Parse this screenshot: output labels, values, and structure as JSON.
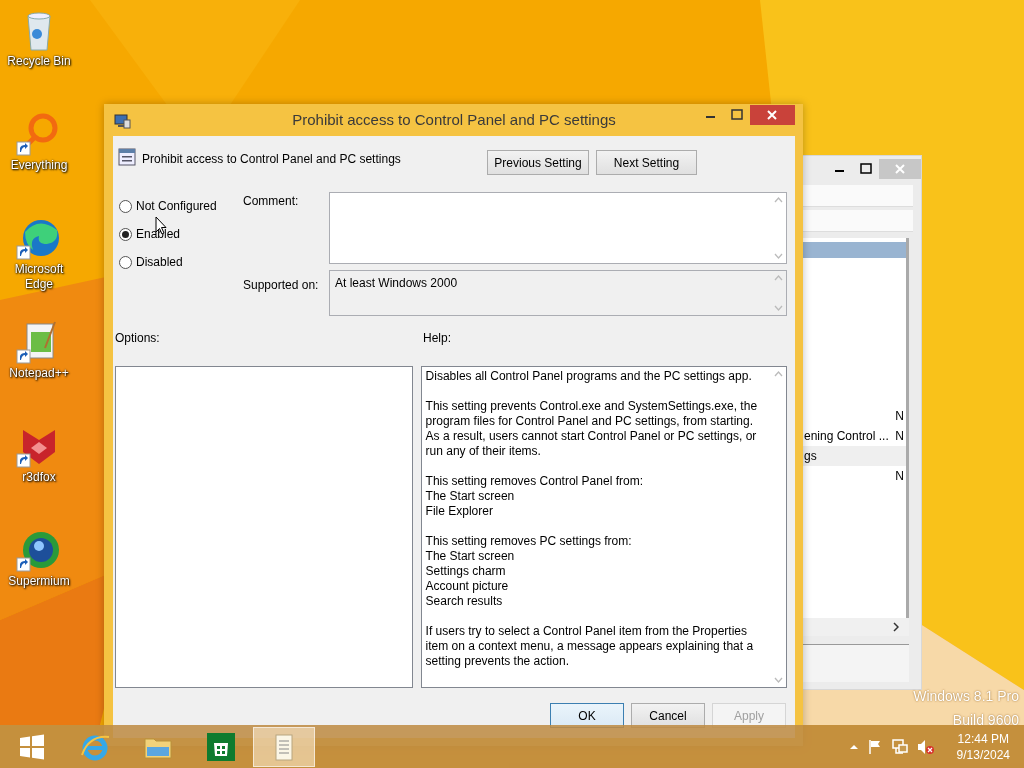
{
  "desktop_icons": [
    {
      "kind": "recycle",
      "label": "Recycle Bin"
    },
    {
      "kind": "ring",
      "label": "Everything"
    },
    {
      "kind": "swirl",
      "label": "Microsoft Edge"
    },
    {
      "kind": "notepad",
      "label": "Notepad++"
    },
    {
      "kind": "fox",
      "label": "r3dfox"
    },
    {
      "kind": "globe",
      "label": "Supermium"
    }
  ],
  "background_window": {
    "rows": [
      {
        "kind": "item",
        "selected": true
      },
      {
        "kind": "item",
        "selected": false,
        "value": "N"
      },
      {
        "kind": "item",
        "selected": false,
        "text": "ening Control ...",
        "value": "N"
      },
      {
        "kind": "group",
        "text": "gs"
      },
      {
        "kind": "item",
        "selected": false,
        "value": "N"
      }
    ]
  },
  "dialog": {
    "title": "Prohibit access to Control Panel and PC settings",
    "setting_name": "Prohibit access to Control Panel and PC settings",
    "nav_buttons": [
      "Previous Setting",
      "Next Setting"
    ],
    "radios": [
      {
        "label": "Not Configured",
        "selected": false
      },
      {
        "label": "Enabled",
        "selected": true
      },
      {
        "label": "Disabled",
        "selected": false
      }
    ],
    "comment_label": "Comment:",
    "supported_label": "Supported on:",
    "supported_value": "At least Windows 2000",
    "options_label": "Options:",
    "help_label": "Help:",
    "help": [
      [
        "Disables all Control Panel programs and the PC settings app."
      ],
      [
        "This setting prevents Control.exe and SystemSettings.exe, the program files for Control Panel and PC settings, from starting. As a result, users cannot start Control Panel or PC settings, or run any of their items."
      ],
      [
        "This setting removes Control Panel from:",
        "The Start screen",
        "File Explorer"
      ],
      [
        "This setting removes PC settings from:",
        "The Start screen",
        "Settings charm",
        "Account picture",
        "Search results"
      ],
      [
        "If users try to select a Control Panel item from the Properties item on a context menu, a message appears explaining that a setting prevents the action."
      ]
    ],
    "footer_buttons": [
      {
        "label": "OK",
        "default": true,
        "disabled": false
      },
      {
        "label": "Cancel",
        "default": false,
        "disabled": false
      },
      {
        "label": "Apply",
        "default": false,
        "disabled": true
      }
    ]
  },
  "os_watermark": [
    "Windows 8.1 Pro",
    "Build 9600"
  ],
  "taskbar": {
    "apps": [
      {
        "kind": "start",
        "active": false
      },
      {
        "kind": "browser",
        "active": false
      },
      {
        "kind": "folder",
        "active": false
      },
      {
        "kind": "store",
        "active": false
      },
      {
        "kind": "notepad",
        "active": true
      }
    ],
    "time": "12:44 PM",
    "date": "9/13/2024"
  }
}
